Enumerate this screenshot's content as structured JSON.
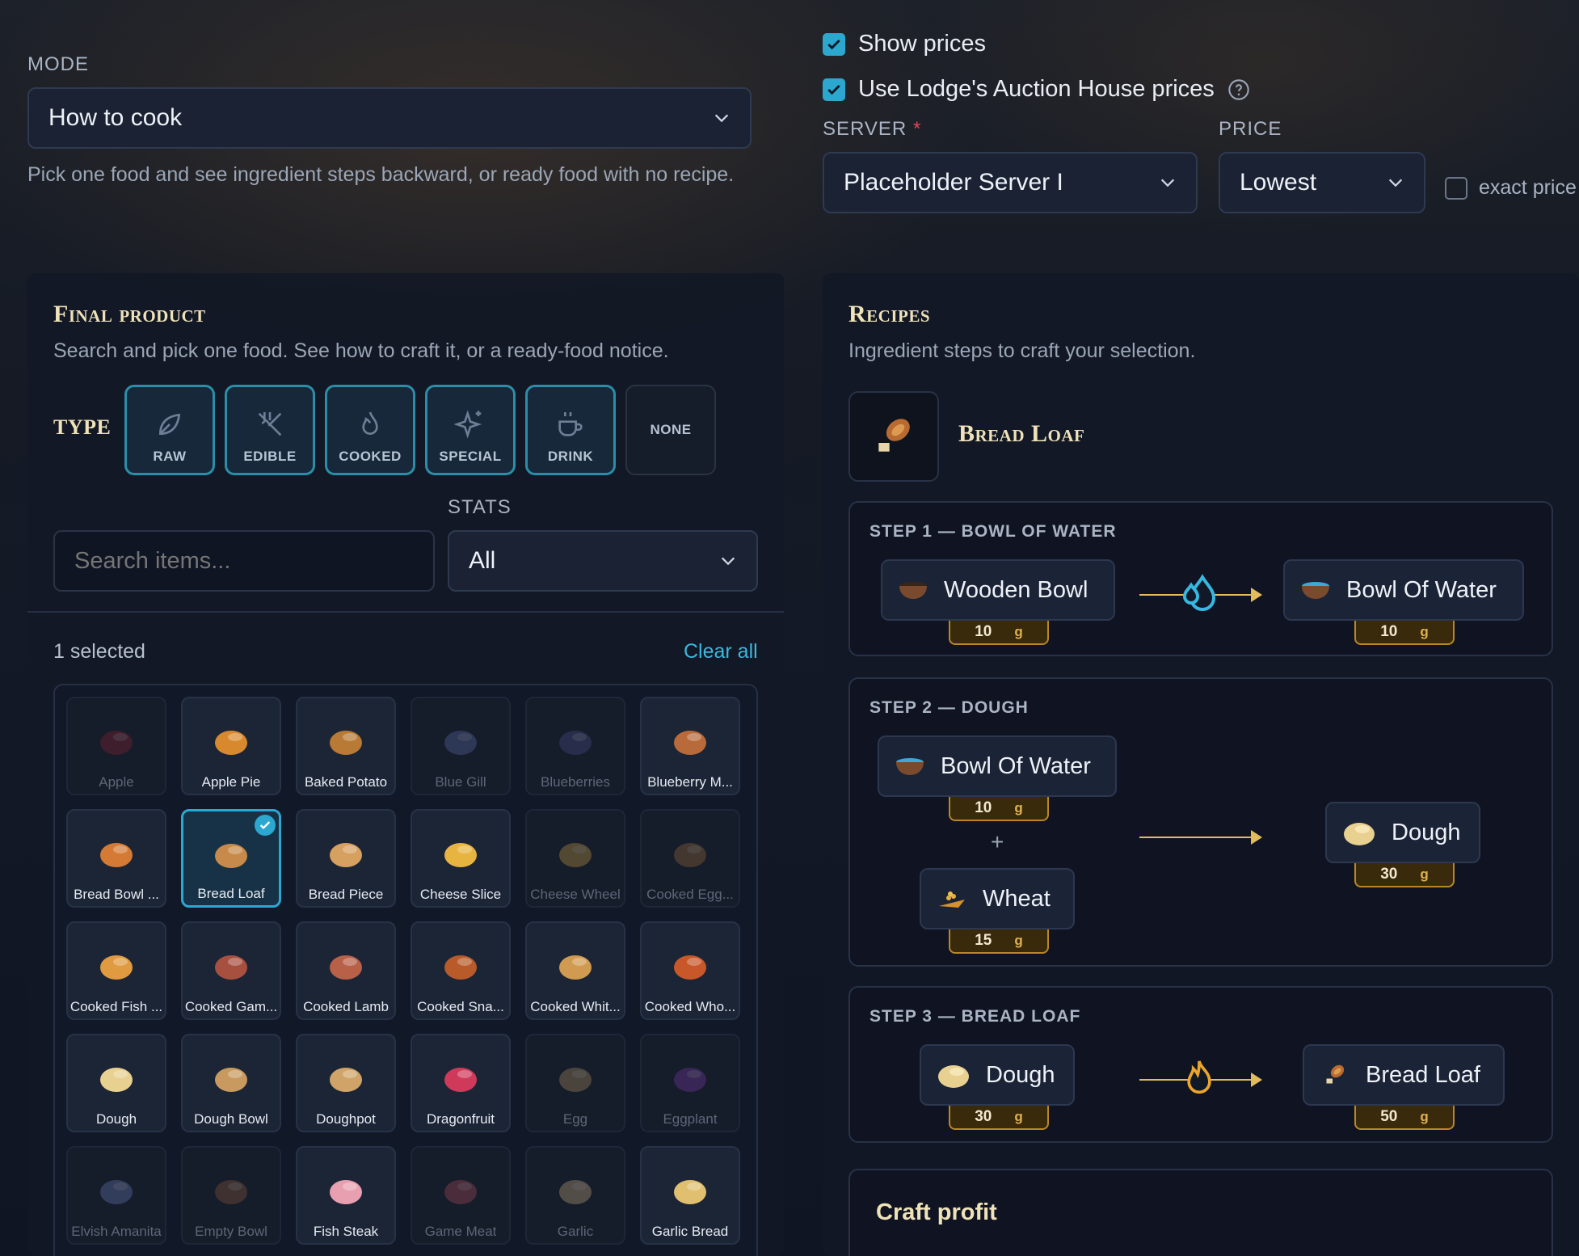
{
  "mode": {
    "label": "MODE",
    "selected": "How to cook",
    "hint": "Pick one food and see ingredient steps backward, or ready food with no recipe."
  },
  "options": {
    "show_prices": "Show prices",
    "use_lodge": "Use Lodge's Auction House prices",
    "server_label": "SERVER",
    "server_required": "*",
    "server_value": "Placeholder Server I",
    "price_label": "PRICE",
    "price_value": "Lowest",
    "exact_price": "exact price"
  },
  "final_product": {
    "title": "Final product",
    "subtitle": "Search and pick one food. See how to craft it, or a ready-food notice.",
    "type_label": "TYPE",
    "types": [
      "RAW",
      "EDIBLE",
      "COOKED",
      "SPECIAL",
      "DRINK",
      "NONE"
    ],
    "stats_label": "STATS",
    "search_placeholder": "Search items...",
    "stats_value": "All",
    "selected_count": "1 selected",
    "clear_all": "Clear all",
    "items": [
      {
        "name": "Apple",
        "dim": true,
        "color": "#8a2030"
      },
      {
        "name": "Apple Pie",
        "dim": false,
        "color": "#d8892e"
      },
      {
        "name": "Baked Potato",
        "dim": false,
        "color": "#b87a34"
      },
      {
        "name": "Blue Gill",
        "dim": true,
        "color": "#5a6aa8"
      },
      {
        "name": "Blueberries",
        "dim": true,
        "color": "#4a4f8a"
      },
      {
        "name": "Blueberry M...",
        "dim": false,
        "color": "#b86a3a"
      },
      {
        "name": "Bread Bowl ...",
        "dim": false,
        "color": "#d47a34"
      },
      {
        "name": "Bread Loaf",
        "dim": false,
        "selected": true,
        "color": "#c88a4a"
      },
      {
        "name": "Bread Piece",
        "dim": false,
        "color": "#d6a060"
      },
      {
        "name": "Cheese Slice",
        "dim": false,
        "color": "#e8b440"
      },
      {
        "name": "Cheese Wheel",
        "dim": true,
        "color": "#c89a40"
      },
      {
        "name": "Cooked Egg...",
        "dim": true,
        "color": "#9a6a3a"
      },
      {
        "name": "Cooked Fish ...",
        "dim": false,
        "color": "#e09a40"
      },
      {
        "name": "Cooked Gam...",
        "dim": false,
        "color": "#a85040"
      },
      {
        "name": "Cooked Lamb",
        "dim": false,
        "color": "#b86048"
      },
      {
        "name": "Cooked Sna...",
        "dim": false,
        "color": "#b85a2a"
      },
      {
        "name": "Cooked Whit...",
        "dim": false,
        "color": "#d09a50"
      },
      {
        "name": "Cooked Who...",
        "dim": false,
        "color": "#c8582a"
      },
      {
        "name": "Dough",
        "dim": false,
        "color": "#e8d090"
      },
      {
        "name": "Dough Bowl",
        "dim": false,
        "color": "#c89a60"
      },
      {
        "name": "Doughpot",
        "dim": false,
        "color": "#d0a468"
      },
      {
        "name": "Dragonfruit",
        "dim": false,
        "color": "#d03a5a"
      },
      {
        "name": "Egg",
        "dim": true,
        "color": "#b09060"
      },
      {
        "name": "Eggplant",
        "dim": true,
        "color": "#7a3aa8"
      },
      {
        "name": "Elvish Amanita",
        "dim": true,
        "color": "#6a7ab8"
      },
      {
        "name": "Empty Bowl",
        "dim": true,
        "color": "#8a5a3a"
      },
      {
        "name": "Fish Steak",
        "dim": false,
        "color": "#e8a0b0"
      },
      {
        "name": "Game Meat",
        "dim": true,
        "color": "#b04a5a"
      },
      {
        "name": "Garlic",
        "dim": true,
        "color": "#c8a880"
      },
      {
        "name": "Garlic Bread",
        "dim": false,
        "color": "#e0c070"
      }
    ]
  },
  "recipes": {
    "title": "Recipes",
    "subtitle": "Ingredient steps to craft your selection.",
    "product": "Bread Loaf",
    "steps": [
      {
        "title": "STEP 1 — BOWL OF WATER",
        "inputs": [
          {
            "name": "Wooden Bowl",
            "price": "10",
            "unit": "g"
          }
        ],
        "output": {
          "name": "Bowl Of Water",
          "price": "10",
          "unit": "g"
        },
        "station": "water-icon"
      },
      {
        "title": "STEP 2 — DOUGH",
        "inputs": [
          {
            "name": "Bowl Of Water",
            "price": "10",
            "unit": "g"
          },
          {
            "name": "Wheat",
            "price": "15",
            "unit": "g"
          }
        ],
        "plus": "+",
        "output": {
          "name": "Dough",
          "price": "30",
          "unit": "g"
        }
      },
      {
        "title": "STEP 3 — BREAD LOAF",
        "inputs": [
          {
            "name": "Dough",
            "price": "30",
            "unit": "g"
          }
        ],
        "output": {
          "name": "Bread Loaf",
          "price": "50",
          "unit": "g"
        },
        "station": "fire-icon"
      }
    ],
    "craft_profit": "Craft profit"
  },
  "colors": {
    "accent": "#2ba7d0",
    "gold": "#e2bb5d",
    "title": "#efe2b8"
  }
}
